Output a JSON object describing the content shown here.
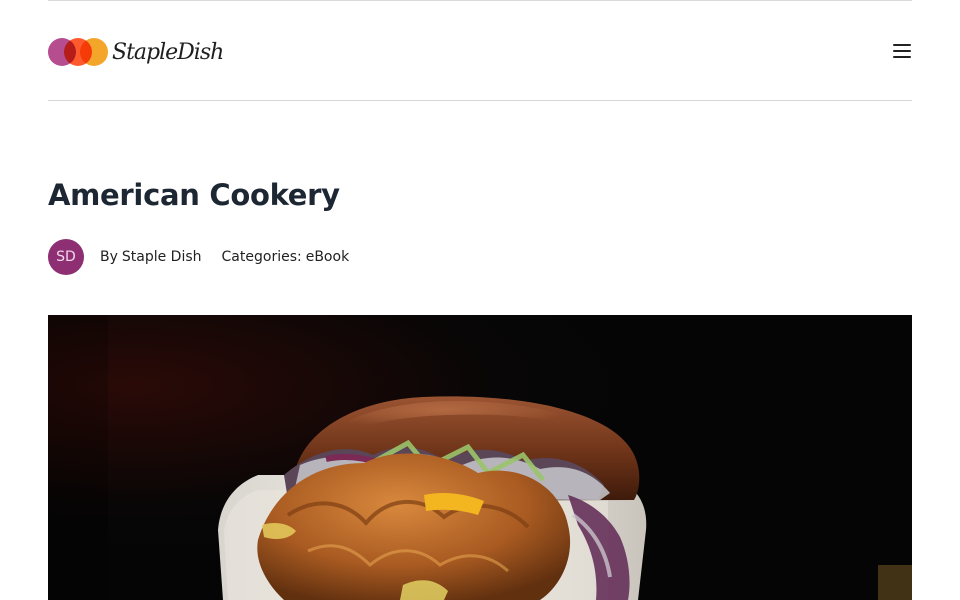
{
  "header": {
    "logo_text": "StapleDish",
    "logo_colors": [
      "#b54d8f",
      "#ff5a2e",
      "#f4a62a"
    ],
    "menu_icon": "hamburger-menu-icon"
  },
  "post": {
    "title": "American Cookery",
    "avatar_initials": "SD",
    "avatar_color": "#8e2f73",
    "author_prefix": "By",
    "author": "Staple Dish",
    "categories_label": "Categories:",
    "category": "eBook"
  },
  "hero": {
    "icon": "burger-photo",
    "background": "#070606"
  }
}
